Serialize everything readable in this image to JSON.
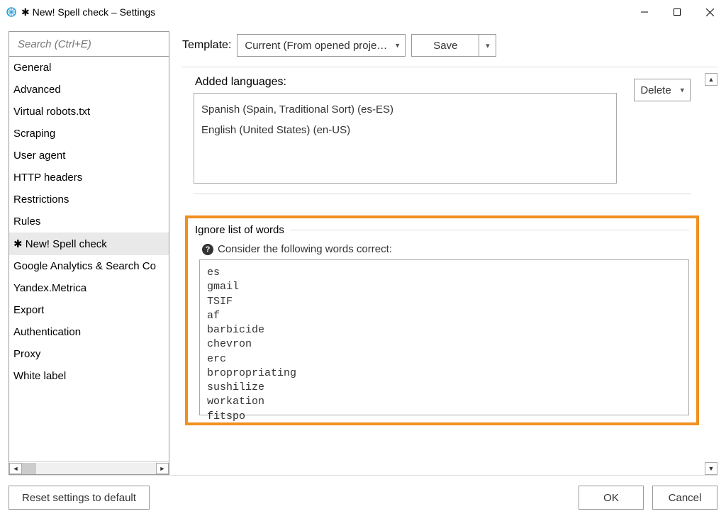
{
  "window": {
    "title": "✱ New! Spell check – Settings"
  },
  "search": {
    "placeholder": "Search (Ctrl+E)"
  },
  "sidebar": {
    "items": [
      {
        "label": "General"
      },
      {
        "label": "Advanced"
      },
      {
        "label": "Virtual robots.txt"
      },
      {
        "label": "Scraping"
      },
      {
        "label": "User agent"
      },
      {
        "label": "HTTP headers"
      },
      {
        "label": "Restrictions"
      },
      {
        "label": "Rules"
      },
      {
        "label": "✱ New! Spell check",
        "selected": true
      },
      {
        "label": "Google Analytics & Search Co"
      },
      {
        "label": "Yandex.Metrica"
      },
      {
        "label": "Export"
      },
      {
        "label": "Authentication"
      },
      {
        "label": "Proxy"
      },
      {
        "label": "White label"
      }
    ]
  },
  "template": {
    "label": "Template:",
    "value": "Current (From opened proje…",
    "save_label": "Save"
  },
  "languages": {
    "group_label": "Added languages:",
    "items": [
      "Spanish (Spain, Traditional Sort) (es-ES)",
      "English (United States) (en-US)"
    ],
    "delete_label": "Delete"
  },
  "ignore": {
    "group_label": "Ignore list of words",
    "consider_label": "Consider the following words correct:",
    "words": "es\ngmail\nTSIF\naf\nbarbicide\nchevron\nerc\nbropropriating\nsushilize\nworkation\nfitspo"
  },
  "footer": {
    "reset_label": "Reset settings to default",
    "ok_label": "OK",
    "cancel_label": "Cancel"
  }
}
